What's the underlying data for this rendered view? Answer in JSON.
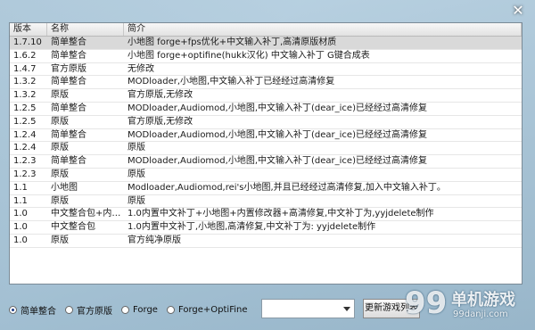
{
  "close_glyph": "✕",
  "columns": [
    "版本",
    "名称",
    "简介"
  ],
  "rows": [
    {
      "version": "1.7.10",
      "name": "简单整合",
      "desc": "小地图 forge+fps优化+中文输入补丁,高清原版材质"
    },
    {
      "version": "1.6.2",
      "name": "简单整合",
      "desc": "小地图 forge+optifine(hukk汉化) 中文输入补丁 G键合成表"
    },
    {
      "version": "1.4.7",
      "name": "官方原版",
      "desc": "无修改"
    },
    {
      "version": "1.3.2",
      "name": "简单整合",
      "desc": "MODloader,小地图,中文输入补丁已经经过高清修复"
    },
    {
      "version": "1.3.2",
      "name": "原版",
      "desc": "官方原版,无修改"
    },
    {
      "version": "1.2.5",
      "name": "简单整合",
      "desc": "MODloader,Audiomod,小地图,中文输入补丁(dear_ice)已经经过高清修复"
    },
    {
      "version": "1.2.5",
      "name": "原版",
      "desc": "官方原版,无修改"
    },
    {
      "version": "1.2.4",
      "name": "简单整合",
      "desc": "MODloader,Audiomod,小地图,中文输入补丁(dear_ice)已经经过高清修复"
    },
    {
      "version": "1.2.4",
      "name": "原版",
      "desc": "原版"
    },
    {
      "version": "1.2.3",
      "name": "简单整合",
      "desc": "MODloader,Audiomod,小地图,中文输入补丁(dear_ice)已经经过高清修复"
    },
    {
      "version": "1.2.3",
      "name": "原版",
      "desc": "原版"
    },
    {
      "version": "1.1",
      "name": "小地图",
      "desc": "Modloader,Audiomod,rei's小地图,并且已经经过高清修复,加入中文输入补丁。"
    },
    {
      "version": "1.1",
      "name": "原版",
      "desc": "原版"
    },
    {
      "version": "1.0",
      "name": "中文整合包+内…",
      "desc": "1.0内置中文补丁+小地图+内置修改器+高清修复,中文补丁为,yyjdelete制作"
    },
    {
      "version": "1.0",
      "name": "中文整合包",
      "desc": "1.0内置中文补丁,小地图,高清修复,中文补丁为: yyjdelete制作"
    },
    {
      "version": "1.0",
      "name": "原版",
      "desc": "官方纯净原版"
    }
  ],
  "selected_row": 0,
  "filters": [
    {
      "label": "简单整合",
      "checked": true
    },
    {
      "label": "官方原版",
      "checked": false
    },
    {
      "label": "Forge",
      "checked": false
    },
    {
      "label": "Forge+OptiFine",
      "checked": false
    }
  ],
  "select_value": "",
  "refresh_label": "更新游戏列表",
  "watermark": {
    "number": "99",
    "name": "单机游戏",
    "url": "99danji.com"
  }
}
